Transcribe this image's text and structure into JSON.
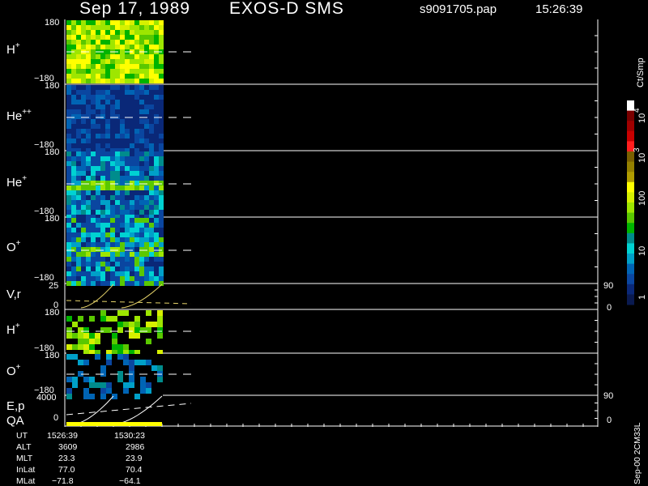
{
  "header": {
    "date": "Sep 17, 1989",
    "instrument": "EXOS-D SMS",
    "file": "s9091705.pap",
    "time": "15:26:39"
  },
  "colorbar": {
    "unit_label": "Ct/Smp",
    "labels": [
      "10",
      "4",
      "10",
      "3",
      "100",
      "10",
      "1"
    ],
    "colors": [
      "#ffffff",
      "#7a0000",
      "#a00000",
      "#c80000",
      "#ff1e1e",
      "#7a6000",
      "#948000",
      "#b09c00",
      "#ffff00",
      "#d6f000",
      "#9ee600",
      "#5ac800",
      "#00b400",
      "#008c8c",
      "#00d2d2",
      "#00a0c8",
      "#0064b4",
      "#0a46a0",
      "#0a2878",
      "#0a1a50"
    ]
  },
  "right_label": "Sep-00 2CM33L",
  "panels": [
    {
      "id": "hp1",
      "species": "H",
      "charge": "+",
      "ticks": {
        "top": "180",
        "bottom": "−180"
      }
    },
    {
      "id": "hepp",
      "species": "He",
      "charge": "++",
      "ticks": {
        "top": "180",
        "bottom": "−180"
      }
    },
    {
      "id": "hep",
      "species": "He",
      "charge": "+",
      "ticks": {
        "top": "180",
        "bottom": "−180"
      }
    },
    {
      "id": "op1",
      "species": "O",
      "charge": "+",
      "ticks": {
        "top": "180",
        "bottom": "−180"
      }
    },
    {
      "id": "vr",
      "species": "V,r",
      "charge": "",
      "ticks": {
        "top": "25",
        "bottom": "0"
      },
      "right_ticks": {
        "top": "90",
        "bottom": "0"
      }
    },
    {
      "id": "hp2",
      "species": "H",
      "charge": "+",
      "ticks": {
        "top": "180",
        "bottom": "−180"
      }
    },
    {
      "id": "op2",
      "species": "O",
      "charge": "+",
      "ticks": {
        "top": "180",
        "bottom": "−180"
      }
    },
    {
      "id": "ep",
      "species": "E,p",
      "species2": "QA",
      "charge": "",
      "ticks": {
        "top": "4000",
        "bottom": "0"
      },
      "right_ticks": {
        "top": "90",
        "bottom": "0"
      }
    }
  ],
  "footer": {
    "rows": [
      {
        "label": "UT",
        "v1": "1526:39",
        "v2": "1530:23"
      },
      {
        "label": "ALT",
        "v1": "3609",
        "v2": "2986"
      },
      {
        "label": "MLT",
        "v1": "23.3",
        "v2": "23.9"
      },
      {
        "label": "InLat",
        "v1": "77.0",
        "v2": "70.4"
      },
      {
        "label": "MLat",
        "v1": "−71.8",
        "v2": "−64.1"
      }
    ]
  },
  "chart_data": {
    "type": "heatmap",
    "title": "Sep 17, 1989   EXOS-D SMS",
    "time_range": [
      "1526:39",
      "1530:23"
    ],
    "panels": [
      {
        "name": "H+",
        "ylim": [
          -180,
          180
        ],
        "dominant_level": "100-1000 Ct/Smp"
      },
      {
        "name": "He++",
        "ylim": [
          -180,
          180
        ],
        "dominant_level": "1-10 Ct/Smp"
      },
      {
        "name": "He+",
        "ylim": [
          -180,
          180
        ],
        "dominant_level": "1-10 Ct/Smp"
      },
      {
        "name": "O+",
        "ylim": [
          -180,
          180
        ],
        "dominant_level": "1-100 Ct/Smp"
      },
      {
        "name": "V,r",
        "ylim": [
          0,
          25
        ],
        "right_ylim": [
          0,
          90
        ]
      },
      {
        "name": "H+",
        "ylim": [
          -180,
          180
        ]
      },
      {
        "name": "O+",
        "ylim": [
          -180,
          180
        ]
      },
      {
        "name": "E,p",
        "ylim": [
          0,
          4000
        ],
        "right_ylim": [
          0,
          90
        ]
      }
    ],
    "colorbar_range": [
      1,
      10000
    ],
    "colorbar_scale": "log"
  }
}
